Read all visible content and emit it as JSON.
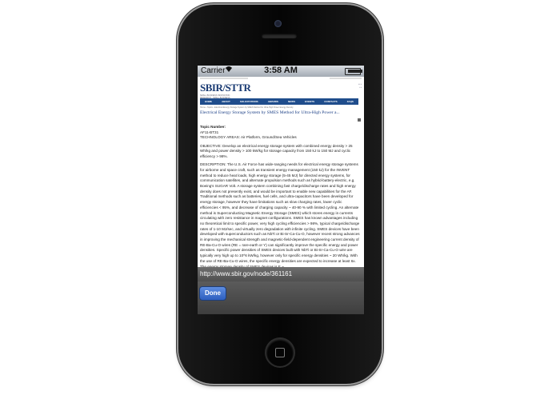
{
  "status": {
    "carrier": "Carrier",
    "time": "3:58 AM"
  },
  "web": {
    "logo": "SBIR/STTR",
    "logo_sub": "SMALL BUSINESS INNOVATION RESEARCH · SMALL BUSINESS TECHNOLOGY TRANSFER",
    "nav": [
      "HOME",
      "ABOUT",
      "SOLICITATIONS",
      "AWARDS",
      "NEWS",
      "EVENTS",
      "CONTACTS",
      "FAQS"
    ],
    "breadcrumb": "Home › Topics › Electrical Energy Storage System by SMES Method for Ultra-High Power Energy Density",
    "title": "Electrical Energy Storage System by SMES Method for Ultra-High Power a...",
    "topic_label": "Topic Number:",
    "topic_number": "AF11-BT31",
    "tech_areas": "TECHNOLOGY AREAS: Air Platform, Ground/Sea Vehicles",
    "objective": "OBJECTIVE:  Develop an electrical energy storage system with combined energy density > 25 Wh/kg and power density > 100 kW/kg for storage capacity from 150 kJ to 150 MJ and cyclic efficiency > 98%.",
    "description": "DESCRIPTION:  The U.S. Air Force has wide-ranging needs for electrical energy storage systems for airborne and space craft, such as transient energy management (150 kJ) for the INVENT method to reduce heat loads, high energy storage (5-45 MJ) for directed energy systems, for communication satellites, and alternate propulsion methods such as hybrid-battery-electric, e.g. Boeing's SUGAR Volt.  A storage system combining fast charge/discharge rates and high energy density does not presently exist, and would be important to enable new capabilities for the AF.  Traditional methods such as batteries, fuel cells, and ultra-capacitors have been developed for energy storage, however they have limitations such as slow charging rates, lower cyclic efficiencies < 95%, and decrease of charging capacity ~ 40-90 % with limited cycling.  An alternate method is Superconducting Magnetic Energy Storage (SMES) which stores energy in currents circulating with zero resistance in magnet configurations.  SMES has known advantages including no theoretical limit to specific power, very high cycling efficiencies > 98%, typical charge/discharge rates of 1-10 MJ/sec, and virtually zero degradation with infinite cycling.  SMES devices have been developed with superconductors such as NbTi or Bi-Sr-Ca-Cu-O, however recent strong advances in improving the mechanical strength and magnetic-field-dependent engineering current density of RE-Ba-Cu-O wires (RE = rare-earth or Y) can significantly improve the specific energy and power densities.  Specific power densities of SMES devices built with NbTi or Bi-Sr-Ca-Cu-O wire are typically very high up to 10^6 kW/kg, however only for specific energy densities ~ 20 Wh/kg.  With the use of RE-Ba-Cu-O wires, the specific energy densities are expected to increase at least 6x.  The energy storage density of SMES devices is E ~"
  },
  "url": "http://www.sbir.gov/node/361161",
  "done_label": "Done"
}
